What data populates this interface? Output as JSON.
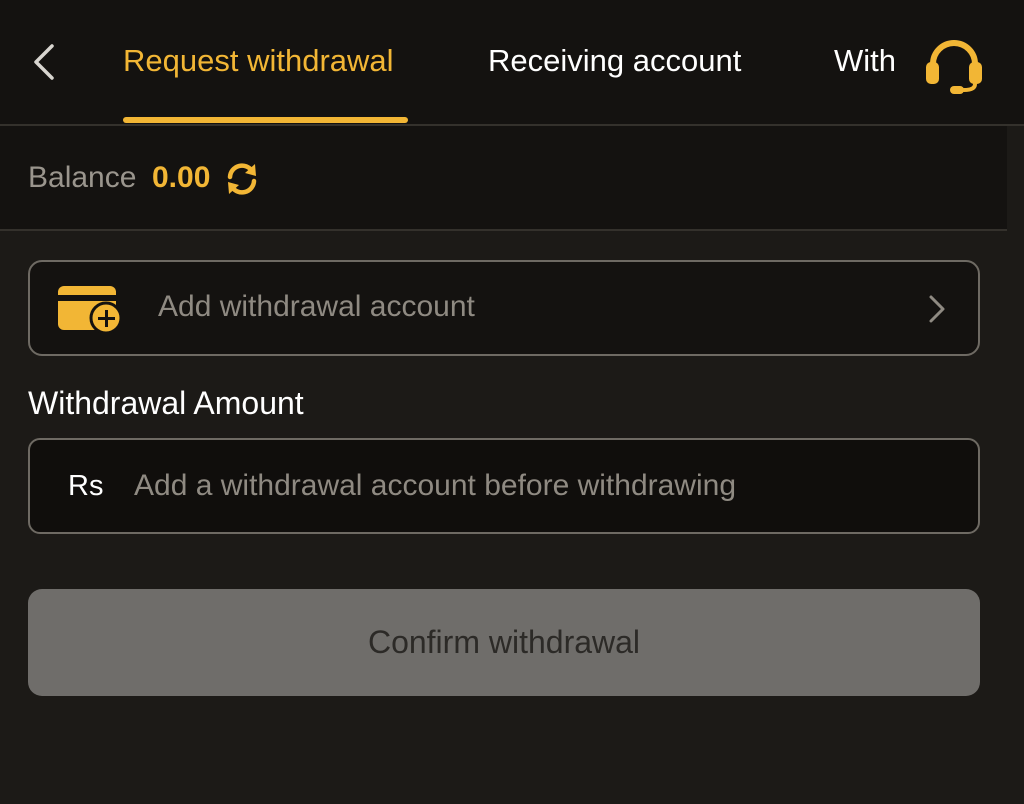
{
  "header": {
    "back_icon": "chevron-left-icon",
    "tabs": [
      {
        "label": "Request withdrawal",
        "active": true
      },
      {
        "label": "Receiving account",
        "active": false
      },
      {
        "label": "Withdrawal history",
        "active": false
      }
    ],
    "support_icon": "headset-icon"
  },
  "balance": {
    "label": "Balance",
    "value": "0.00",
    "refresh_icon": "refresh-icon"
  },
  "account": {
    "icon": "wallet-add-icon",
    "label": "Add withdrawal account",
    "chevron_icon": "chevron-right-icon"
  },
  "amount": {
    "label": "Withdrawal Amount",
    "currency": "Rs",
    "placeholder": "Add a withdrawal account before withdrawing",
    "value": ""
  },
  "confirm": {
    "label": "Confirm withdrawal"
  },
  "colors": {
    "accent": "#f2b635",
    "background": "#1c1a17",
    "panel": "#141210",
    "button_disabled": "#6f6d6a"
  }
}
